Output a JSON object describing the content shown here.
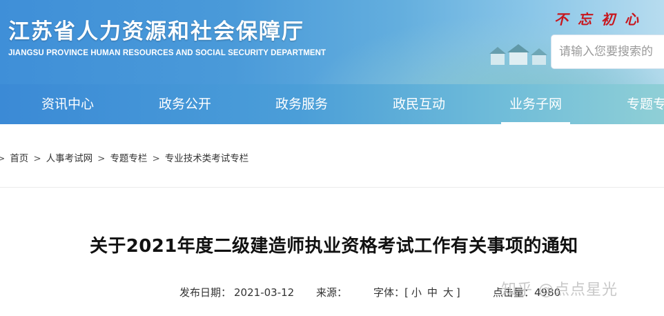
{
  "header": {
    "title": "江苏省人力资源和社会保障厅",
    "subtitle": "JIANGSU PROVINCE HUMAN RESOURCES AND SOCIAL SECURITY DEPARTMENT",
    "slogan": "不忘初心",
    "search_placeholder": "请输入您要搜索的"
  },
  "nav": {
    "items": [
      {
        "label": "资讯中心"
      },
      {
        "label": "政务公开"
      },
      {
        "label": "政务服务"
      },
      {
        "label": "政民互动"
      },
      {
        "label": "业务子网",
        "active": true
      },
      {
        "label": "专题专"
      }
    ]
  },
  "breadcrumb": {
    "items": [
      "首页",
      "人事考试网",
      "专题专栏",
      "专业技术类考试专栏"
    ],
    "separator": ">"
  },
  "article": {
    "title": "关于2021年度二级建造师执业资格考试工作有关事项的通知",
    "date_label": "发布日期：",
    "date": "2021-03-12",
    "source_label": "来源：",
    "font_label": "字体：[",
    "font_small": "小",
    "font_medium": "中",
    "font_large": "大",
    "font_close": "]",
    "views_label": "点击量：",
    "views": "4980"
  },
  "watermark": "知乎 @点点星光",
  "colors": {
    "banner": "#4a9ad9",
    "nav": "#4b9ed8",
    "slogan": "#c8161d"
  }
}
